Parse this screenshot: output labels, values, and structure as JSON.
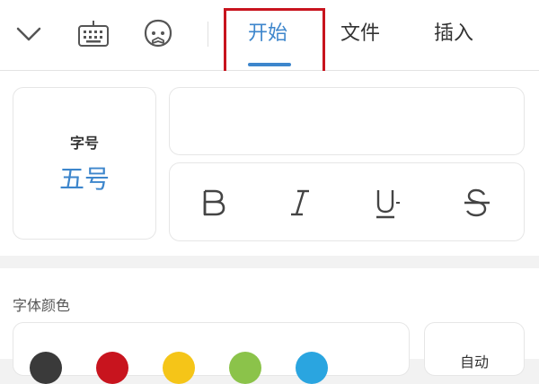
{
  "toolbar": {
    "icons": [
      "chevron-down-icon",
      "keyboard-icon",
      "voice-assistant-icon"
    ],
    "tabs": [
      {
        "label": "开始",
        "active": true
      },
      {
        "label": "文件",
        "active": false
      },
      {
        "label": "插入",
        "active": false
      }
    ]
  },
  "font_size": {
    "label": "字号",
    "value": "五号"
  },
  "format_buttons": [
    "bold-icon",
    "italic-icon",
    "underline-icon",
    "strikethrough-icon"
  ],
  "font_color": {
    "label": "字体颜色",
    "swatches": [
      "#3a3a3a",
      "#c8141e",
      "#f5c518",
      "#8bc34a",
      "#2aa5e0"
    ],
    "auto_label": "自动"
  },
  "colors": {
    "accent": "#3d86cc",
    "highlight": "#c8141e"
  }
}
